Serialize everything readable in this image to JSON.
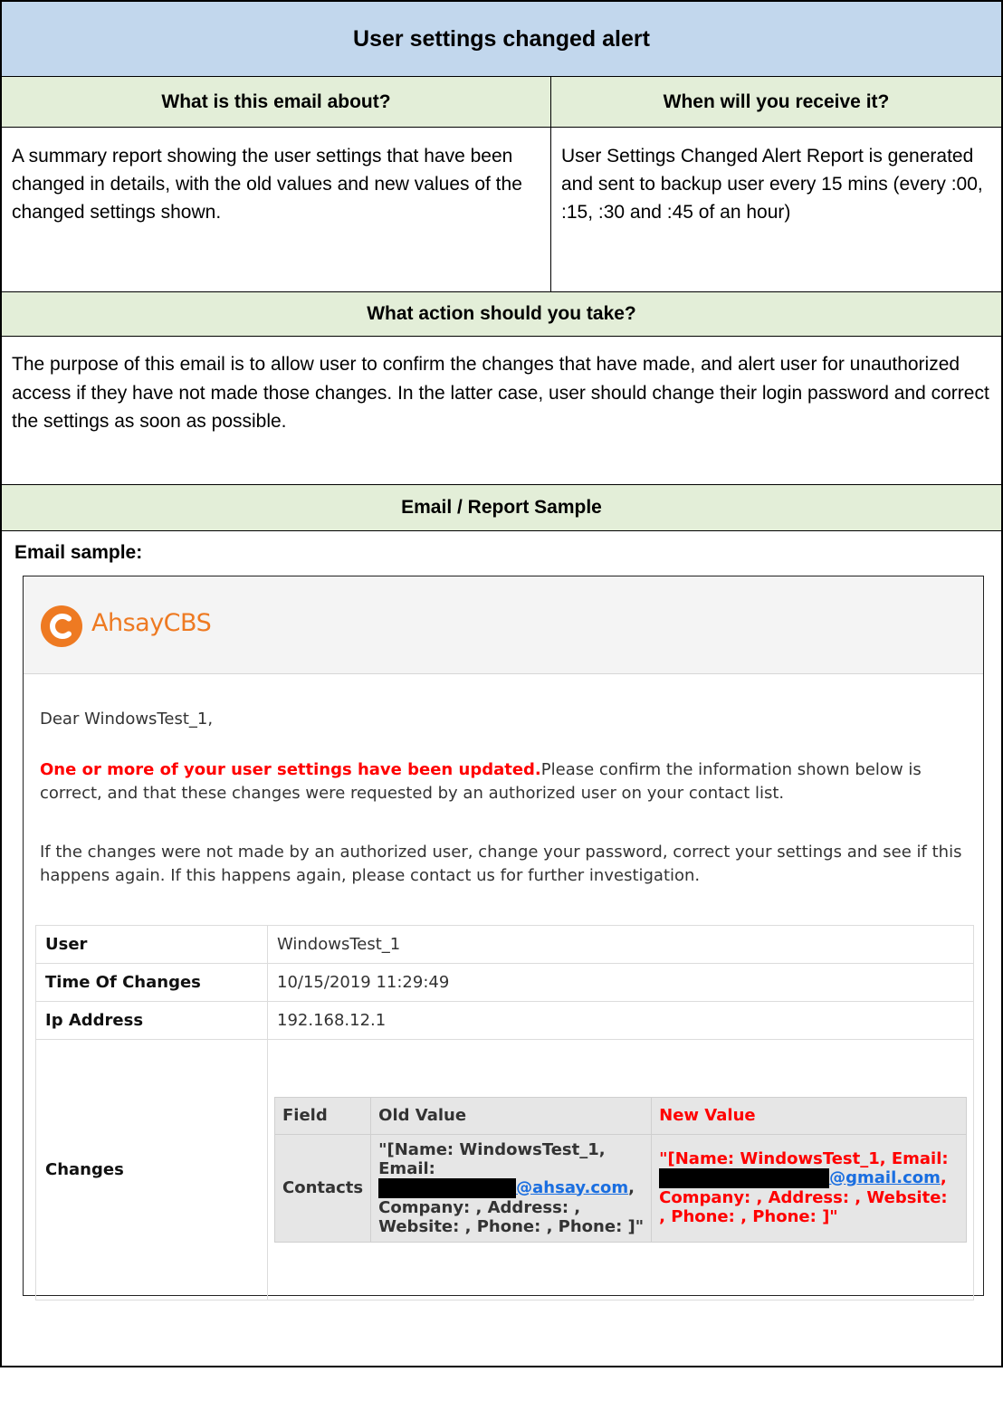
{
  "title": "User settings changed alert",
  "headers": {
    "about": "What is this email about?",
    "when": "When will you receive it?",
    "action": "What action should you take?",
    "sample": "Email / Report Sample"
  },
  "about_text": "A summary report showing the user settings that have been changed in details, with the old values and new values of the changed settings shown.",
  "when_text": "User Settings Changed Alert Report is generated and sent to backup user every 15 mins (every :00, :15, :30 and :45 of an hour)",
  "action_text": "The purpose of this email is to allow user to confirm the changes that have made, and alert user for unauthorized access if they have not made those changes. In the latter case, user should change their login password and correct the settings as soon as possible.",
  "sample_label": "Email sample:",
  "email": {
    "brand": "AhsayCBS",
    "greeting": "Dear WindowsTest_1,",
    "alert_strong": "One or more of your user settings have been updated.",
    "alert_rest": "Please confirm the information shown below is correct, and that these changes were requested by an authorized user on your contact list.",
    "para2": "If the changes were not made by an authorized user, change your password, correct your settings and see if this happens again. If this happens again, please contact us for further investigation.",
    "table": {
      "user_label": "User",
      "user_value": "WindowsTest_1",
      "time_label": "Time Of Changes",
      "time_value": "10/15/2019 11:29:49",
      "ip_label": "Ip Address",
      "ip_value": "192.168.12.1",
      "changes_label": "Changes",
      "changes": {
        "col_field": "Field",
        "col_old": "Old Value",
        "col_new": "New Value",
        "field": "Contacts",
        "old_pre": "\"[Name: WindowsTest_1, Email:",
        "old_link": "@ahsay.com",
        "old_post": ", Company: , Address: , Website: , Phone: , Phone: ]\"",
        "new_pre": "\"[Name: WindowsTest_1, Email:",
        "new_link": "@gmail.com",
        "new_post": ", Company: , Address: , Website: , Phone: , Phone: ]\""
      }
    }
  },
  "colors": {
    "title_bg": "#c2d7ed",
    "header_bg": "#e3eed8",
    "brand_orange": "#ee7a22",
    "alert_red": "#ff0000",
    "link_blue": "#1a6ee0"
  },
  "icons": {
    "logo": "ahsay-logo-icon"
  }
}
